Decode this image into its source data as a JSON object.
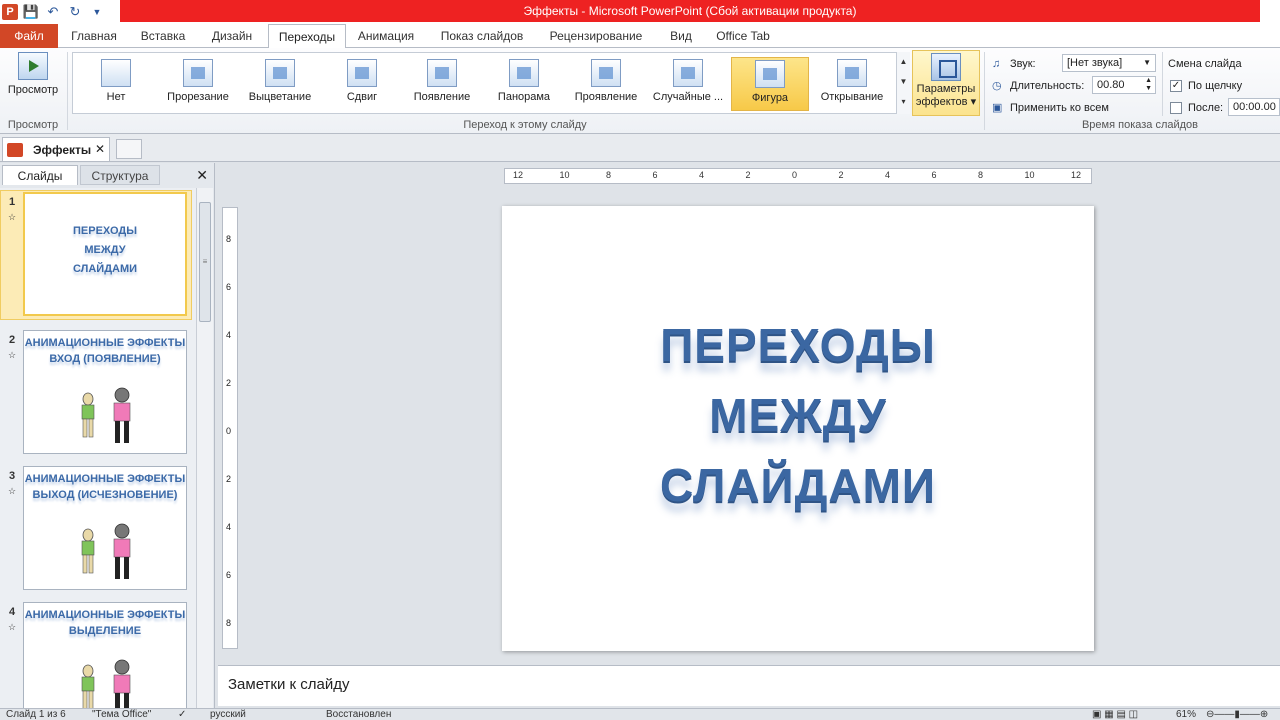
{
  "window": {
    "title": "Эффекты  -  Microsoft PowerPoint (Сбой активации продукта)"
  },
  "qat": {
    "icons": [
      "powerpoint-icon",
      "save-icon",
      "undo-icon",
      "redo-icon",
      "customize-icon"
    ]
  },
  "ribbon_tabs": [
    "Файл",
    "Главная",
    "Вставка",
    "Дизайн",
    "Переходы",
    "Анимация",
    "Показ слайдов",
    "Рецензирование",
    "Вид",
    "Office Tab"
  ],
  "active_tab": "Переходы",
  "ribbon": {
    "preview_label": "Просмотр",
    "preview_group_label": "Просмотр",
    "transitions": [
      "Нет",
      "Прорезание",
      "Выцветание",
      "Сдвиг",
      "Появление",
      "Панорама",
      "Проявление",
      "Случайные ...",
      "Фигура",
      "Открывание"
    ],
    "selected_transition": "Фигура",
    "transition_group_label": "Переход к этому слайду",
    "effects_label_line1": "Параметры",
    "effects_label_line2": "эффектов",
    "timing": {
      "sound_label": "Звук:",
      "sound_value": "[Нет звука]",
      "duration_label": "Длительность:",
      "duration_value": "00.80",
      "apply_all_label": "Применить ко всем",
      "advance_header": "Смена слайда",
      "on_click_label": "По щелчку",
      "on_click_checked": true,
      "after_label": "После:",
      "after_checked": false,
      "after_value": "00:00.00",
      "group_label": "Время показа слайдов"
    }
  },
  "doc_tab": {
    "name": "Эффекты",
    "close": "✕"
  },
  "panel": {
    "tab_slides": "Слайды",
    "tab_outline": "Структура",
    "close": "✕",
    "slides": [
      {
        "num": "1",
        "title": "ПЕРЕХОДЫ\nМЕЖДУ\nСЛАЙДАМИ",
        "selected": true
      },
      {
        "num": "2",
        "title": "АНИМАЦИОННЫЕ ЭФФЕКТЫ\nВХОД (ПОЯВЛЕНИЕ)",
        "selected": false
      },
      {
        "num": "3",
        "title": "АНИМАЦИОННЫЕ ЭФФЕКТЫ\nВЫХОД (ИСЧЕЗНОВЕНИЕ)",
        "selected": false
      },
      {
        "num": "4",
        "title": "АНИМАЦИОННЫЕ ЭФФЕКТЫ\nВЫДЕЛЕНИЕ",
        "selected": false
      }
    ]
  },
  "ruler": {
    "h_ticks": [
      "12",
      "10",
      "8",
      "6",
      "4",
      "2",
      "0",
      "2",
      "4",
      "6",
      "8",
      "10",
      "12"
    ],
    "v_ticks": [
      "8",
      "6",
      "4",
      "2",
      "0",
      "2",
      "4",
      "6",
      "8"
    ]
  },
  "slide": {
    "title_lines": [
      "ПЕРЕХОДЫ",
      "МЕЖДУ",
      "СЛАЙДАМИ"
    ]
  },
  "notes": {
    "placeholder": "Заметки к слайду"
  },
  "status": {
    "slide_counter": "Слайд 1 из 6",
    "theme": "\"Тема Office\"",
    "language": "русский",
    "recovered": "Восстановлен",
    "zoom": "61%"
  }
}
